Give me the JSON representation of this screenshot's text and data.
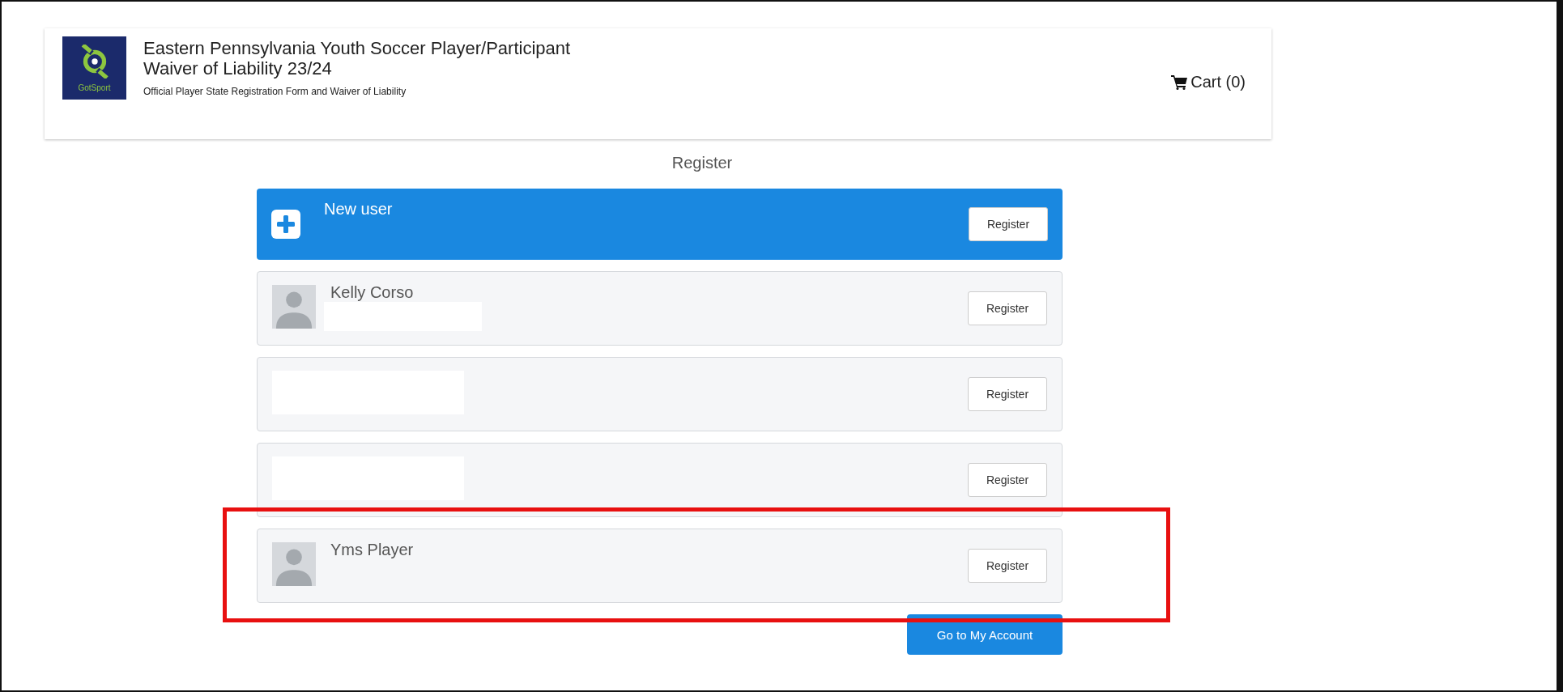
{
  "header": {
    "logo_text": "GotSport",
    "title": "Eastern Pennsylvania Youth Soccer Player/Participant Waiver of Liability 23/24",
    "subtitle": "Official Player State Registration Form and Waiver of Liability",
    "cart": "Cart (0)"
  },
  "heading": "Register",
  "rows": [
    {
      "kind": "new_user",
      "name": "New user",
      "button": "Register",
      "highlighted": false
    },
    {
      "kind": "user",
      "name": "Kelly Corso",
      "button": "Register",
      "redacted_line": true,
      "highlighted": false
    },
    {
      "kind": "redacted_user",
      "button": "Register",
      "highlighted": false
    },
    {
      "kind": "redacted_user",
      "button": "Register",
      "highlighted": false
    },
    {
      "kind": "user",
      "name": "Yms Player",
      "button": "Register",
      "redacted_line": false,
      "highlighted": true
    }
  ],
  "account_button": "Go to My Account"
}
